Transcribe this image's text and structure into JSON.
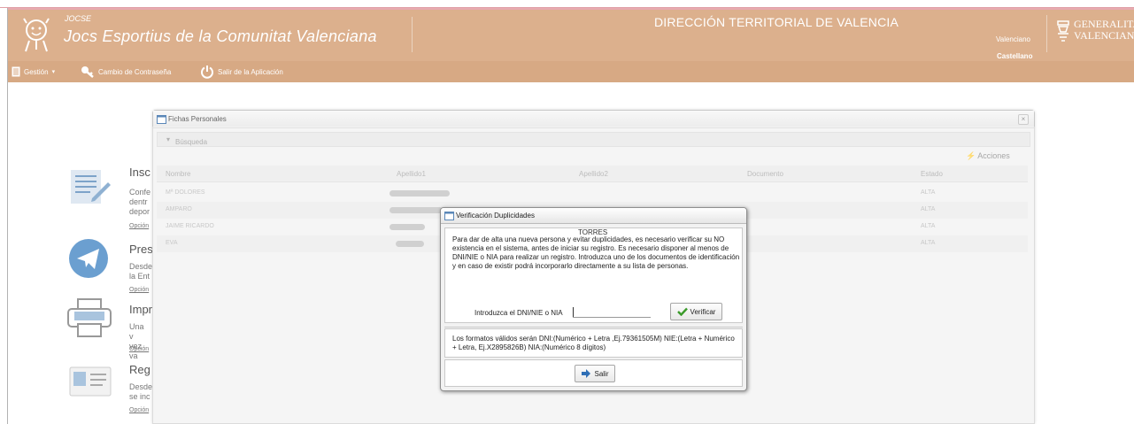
{
  "header": {
    "subtitle": "JOCSE",
    "app_title": "Jocs Esportius de la Comunitat Valenciana",
    "direction": "DIRECCIÓN TERRITORIAL DE VALENCIA",
    "lang_valenciano": "Valenciano",
    "lang_castellano": "Castellano",
    "brand_line1": "GENERALITAT",
    "brand_line2": "VALENCIANA"
  },
  "menu": {
    "gestion": "Gestión",
    "cambio": "Cambio de Contraseña",
    "salir": "Salir de la Aplicación"
  },
  "background_items": [
    {
      "title": "Insc",
      "text": [
        "Confe",
        "dentr",
        "depor"
      ],
      "link": "Opción"
    },
    {
      "title": "Pres",
      "text": [
        "Desde",
        "la Ent"
      ],
      "link": "Opción"
    },
    {
      "title": "Impr",
      "text": [
        "Una v",
        "vez va"
      ],
      "link": "Opción"
    },
    {
      "title": "Reg",
      "text": [
        "Desde",
        "se inc"
      ],
      "link": "Opción"
    }
  ],
  "panel": {
    "title": "Fichas Personales",
    "close": "×",
    "busqueda": "Búsqueda",
    "acciones": "Acciones",
    "columns": [
      "Nombre",
      "Apellido1",
      "Apellido2",
      "Documento",
      "Estado"
    ],
    "rows": [
      {
        "nombre": "Mª DOLORES",
        "estado": "ALTA"
      },
      {
        "nombre": "AMPARO",
        "estado": "ALTA"
      },
      {
        "nombre": "JAIME RICARDO",
        "estado": "ALTA"
      },
      {
        "nombre": "EVA",
        "estado": "ALTA"
      }
    ]
  },
  "dialog": {
    "title": "Verificación Duplicidades",
    "torres": "TORRES",
    "info": "Para dar de alta una nueva persona y evitar duplicidades, es necesario verificar su NO existencia en el sistema, antes de iniciar su registro. Es necesario disponer al menos de DNI/NIE o NIA para realizar un registro. Introduzca uno de los documentos de identificación y en caso de existir podrá incorporarlo directamente a su lista de personas.",
    "dni_label": "Introduzca el DNI/NIE o NIA",
    "dni_value": "",
    "verify_button": "Verificar",
    "formats": "Los formatos válidos serán DNI:(Numérico + Letra ,Ej.79361505M) NIE:(Letra + Numérico + Letra, Ej.X2895826B) NIA:(Numérico 8 dígitos)",
    "exit_button": "Salir"
  },
  "colors": {
    "header": "#dcb08d",
    "menubar": "#d7a984",
    "accent_green": "#3a9a2a"
  }
}
